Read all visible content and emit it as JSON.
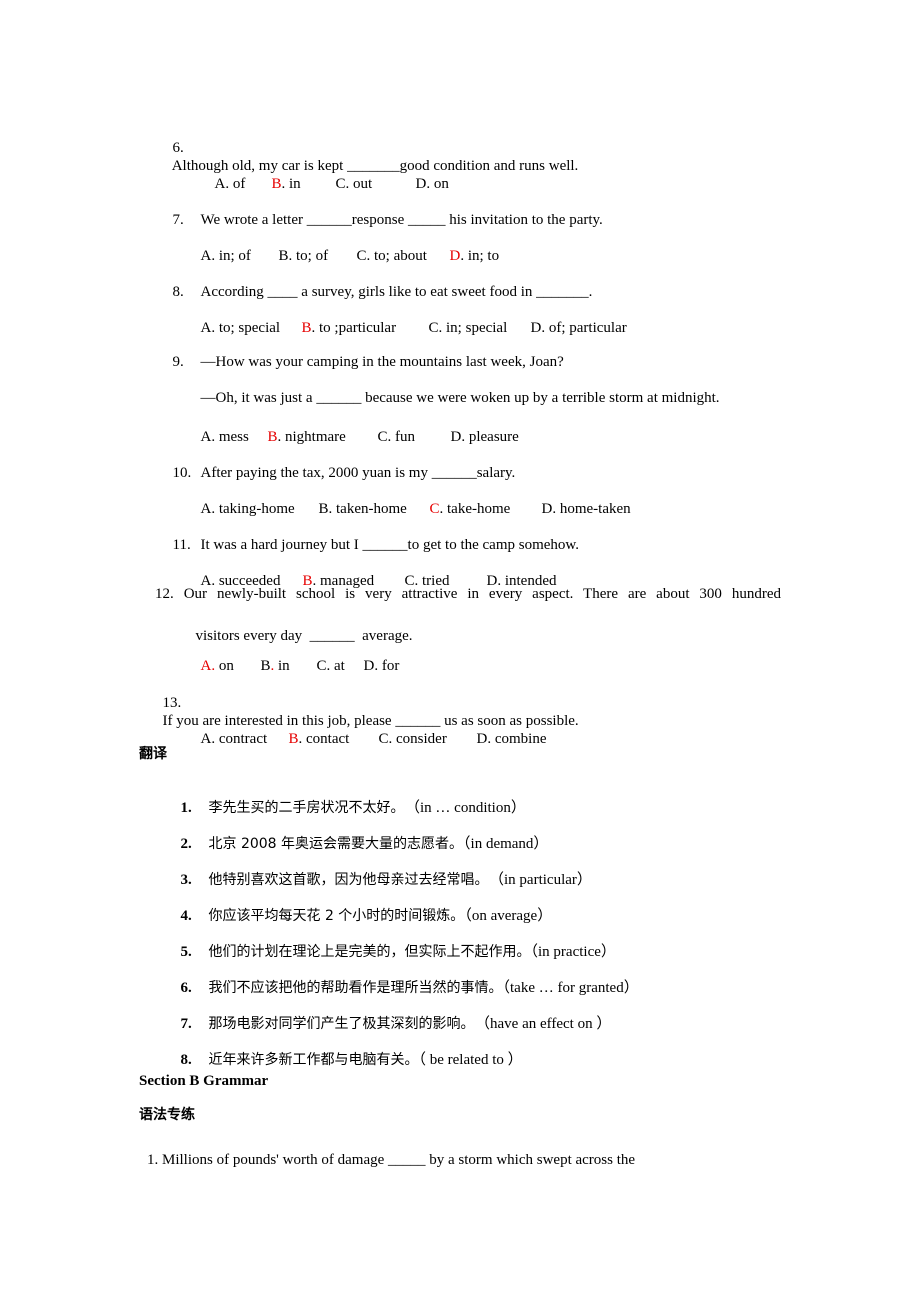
{
  "questions": [
    {
      "number": "6.",
      "stem": "Although old, my car is kept _______good condition and runs well.",
      "options": [
        {
          "letter": "A",
          "text": ". of",
          "correct": false
        },
        {
          "letter": "B",
          "text": ". in",
          "correct": true
        },
        {
          "letter": "C",
          "text": ". out",
          "correct": false
        },
        {
          "letter": "D",
          "text": ". on",
          "correct": false
        }
      ]
    },
    {
      "number": "7.",
      "stem": "We wrote a letter ______response _____ his invitation to the party.",
      "options": [
        {
          "letter": "A",
          "text": ". in; of",
          "correct": false
        },
        {
          "letter": "B",
          "text": ". to; of",
          "correct": false
        },
        {
          "letter": "C",
          "text": ". to; about",
          "correct": false
        },
        {
          "letter": "D",
          "text": ". in; to",
          "correct": true
        }
      ]
    },
    {
      "number": "8.",
      "stem": "According ____ a survey, girls like to eat sweet food in _______.",
      "options": [
        {
          "letter": "A",
          "text": ". to; special",
          "correct": false
        },
        {
          "letter": "B",
          "text": ". to ;particular",
          "correct": true
        },
        {
          "letter": "C",
          "text": ". in; special",
          "correct": false
        },
        {
          "letter": "D",
          "text": ". of; particular",
          "correct": false
        }
      ]
    },
    {
      "number": "9.",
      "stem": "—How was your camping in the mountains last week, Joan?",
      "stem2": "—Oh, it was just a ______ because we were woken up by a terrible storm at midnight.",
      "options": [
        {
          "letter": "A",
          "text": ". mess",
          "correct": false
        },
        {
          "letter": "B",
          "text": ". nightmare",
          "correct": true
        },
        {
          "letter": "C",
          "text": ". fun",
          "correct": false
        },
        {
          "letter": "D",
          "text": ". pleasure",
          "correct": false
        }
      ]
    },
    {
      "number": "10.",
      "stem": "After paying the tax, 2000 yuan is my ______salary.",
      "options": [
        {
          "letter": "A",
          "text": ". taking-home",
          "correct": false
        },
        {
          "letter": "B",
          "text": ". taken-home",
          "correct": false
        },
        {
          "letter": "C",
          "text": ". take-home",
          "correct": true
        },
        {
          "letter": "D",
          "text": ". home-taken",
          "correct": false
        }
      ]
    },
    {
      "number": "11.",
      "stem": "It was a hard journey but I ______to get to the camp somehow.",
      "options": [
        {
          "letter": "A",
          "text": ". succeeded",
          "correct": false
        },
        {
          "letter": "B",
          "text": ". managed",
          "correct": true
        },
        {
          "letter": "C",
          "text": ". tried",
          "correct": false
        },
        {
          "letter": "D",
          "text": ". intended",
          "correct": false
        }
      ]
    },
    {
      "number": "12.",
      "stem": "Our newly-built school is very attractive in every aspect. There are about 300 hundred",
      "stem2": "visitors every day  ______  average.",
      "options": [
        {
          "letter": "A",
          "text": ". on",
          "correct": true
        },
        {
          "letter": "B",
          "text": ". in",
          "correct": false
        },
        {
          "letter": "C",
          "text": ". at",
          "correct": false
        },
        {
          "letter": "D",
          "text": ". for",
          "correct": false
        }
      ]
    },
    {
      "number": "13.",
      "stem": "If you are interested in this job, please ______ us as soon as possible.",
      "options": [
        {
          "letter": "A",
          "text": ". contract",
          "correct": false
        },
        {
          "letter": "B",
          "text": ". contact",
          "correct": true
        },
        {
          "letter": "C",
          "text": ". consider",
          "correct": false
        },
        {
          "letter": "D",
          "text": ". combine",
          "correct": false
        }
      ]
    }
  ],
  "translation": {
    "heading": "翻译",
    "items": [
      {
        "number": "1.",
        "chinese": "李先生买的二手房状况不太好。",
        "hint": "　（in … condition）"
      },
      {
        "number": "2.",
        "chinese": "北京 2008 年奥运会需要大量的志愿者。",
        "hint": "（in demand）"
      },
      {
        "number": "3.",
        "chinese": "他特别喜欢这首歌，因为他母亲过去经常唱。",
        "hint": "　（in particular）"
      },
      {
        "number": "4.",
        "chinese": "你应该平均每天花 2 个小时的时间锻炼。",
        "hint": "（on average）"
      },
      {
        "number": "5.",
        "chinese": "他们的计划在理论上是完美的，但实际上不起作用。",
        "hint": "（in practice）"
      },
      {
        "number": "6.",
        "chinese": "我们不应该把他的帮助看作是理所当然的事情。",
        "hint": "（take … for granted）"
      },
      {
        "number": "7.",
        "chinese": "那场电影对同学们产生了极其深刻的影响。",
        "hint": "　（have an effect on ）"
      },
      {
        "number": "8.",
        "chinese": "近年来许多新工作都与电脑有关。",
        "hint": "（ be related to ）"
      }
    ]
  },
  "grammar": {
    "section_title": "Section B Grammar",
    "subheading": "语法专练",
    "first_question": "1. Millions of pounds' worth of damage _____ by a storm which swept across the"
  },
  "colors": {
    "answer_highlight": "#e60000",
    "text": "#000000"
  }
}
